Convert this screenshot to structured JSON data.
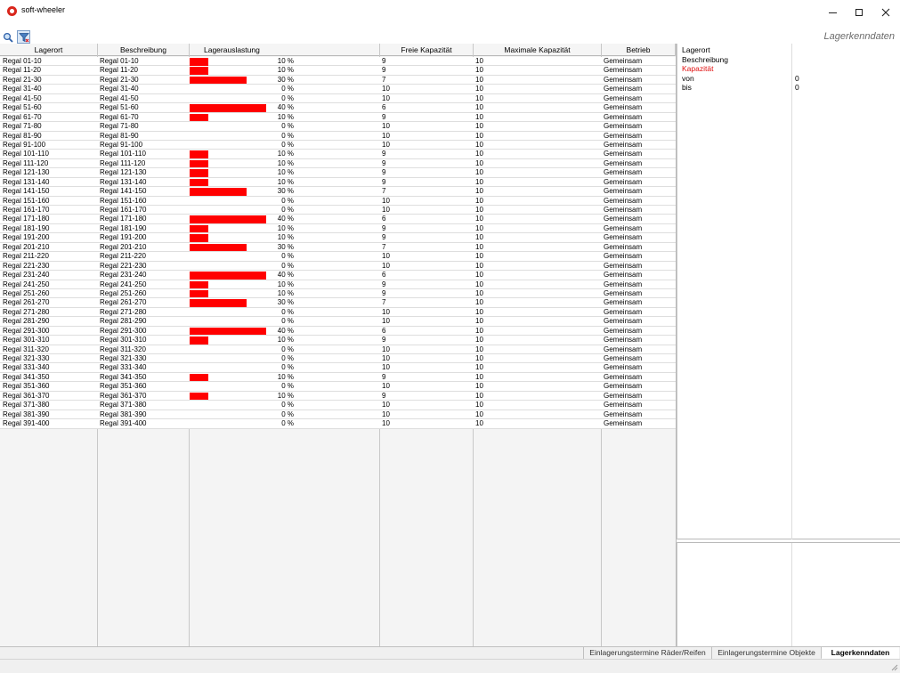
{
  "window": {
    "title": "soft-wheeler"
  },
  "toolbar": {
    "search_icon": "search-icon",
    "filter_icon": "filter-icon",
    "panel_title": "Lagerkenndaten"
  },
  "table": {
    "headers": {
      "lagerort": "Lagerort",
      "beschreibung": "Beschreibung",
      "auslastung": "Lagerauslastung",
      "frei": "Freie Kapazität",
      "max": "Maximale Kapazität",
      "betrieb": "Betrieb"
    },
    "bar_color": "#ff0000",
    "rows": [
      {
        "lagerort": "Regal 01-10",
        "beschreibung": "Regal 01-10",
        "pct_label": "10 %",
        "pct": 10,
        "frei": "9",
        "max": "10",
        "betrieb": "Gemeinsam"
      },
      {
        "lagerort": "Regal 11-20",
        "beschreibung": "Regal 11-20",
        "pct_label": "10 %",
        "pct": 10,
        "frei": "9",
        "max": "10",
        "betrieb": "Gemeinsam"
      },
      {
        "lagerort": "Regal 21-30",
        "beschreibung": "Regal 21-30",
        "pct_label": "30 %",
        "pct": 30,
        "frei": "7",
        "max": "10",
        "betrieb": "Gemeinsam"
      },
      {
        "lagerort": "Regal 31-40",
        "beschreibung": "Regal 31-40",
        "pct_label": "0 %",
        "pct": 0,
        "frei": "10",
        "max": "10",
        "betrieb": "Gemeinsam"
      },
      {
        "lagerort": "Regal 41-50",
        "beschreibung": "Regal 41-50",
        "pct_label": "0 %",
        "pct": 0,
        "frei": "10",
        "max": "10",
        "betrieb": "Gemeinsam"
      },
      {
        "lagerort": "Regal 51-60",
        "beschreibung": "Regal 51-60",
        "pct_label": "40 %",
        "pct": 40,
        "frei": "6",
        "max": "10",
        "betrieb": "Gemeinsam"
      },
      {
        "lagerort": "Regal 61-70",
        "beschreibung": "Regal 61-70",
        "pct_label": "10 %",
        "pct": 10,
        "frei": "9",
        "max": "10",
        "betrieb": "Gemeinsam"
      },
      {
        "lagerort": "Regal 71-80",
        "beschreibung": "Regal 71-80",
        "pct_label": "0 %",
        "pct": 0,
        "frei": "10",
        "max": "10",
        "betrieb": "Gemeinsam"
      },
      {
        "lagerort": "Regal 81-90",
        "beschreibung": "Regal 81-90",
        "pct_label": "0 %",
        "pct": 0,
        "frei": "10",
        "max": "10",
        "betrieb": "Gemeinsam"
      },
      {
        "lagerort": "Regal 91-100",
        "beschreibung": "Regal 91-100",
        "pct_label": "0 %",
        "pct": 0,
        "frei": "10",
        "max": "10",
        "betrieb": "Gemeinsam"
      },
      {
        "lagerort": "Regal 101-110",
        "beschreibung": "Regal 101-110",
        "pct_label": "10 %",
        "pct": 10,
        "frei": "9",
        "max": "10",
        "betrieb": "Gemeinsam"
      },
      {
        "lagerort": "Regal 111-120",
        "beschreibung": "Regal 111-120",
        "pct_label": "10 %",
        "pct": 10,
        "frei": "9",
        "max": "10",
        "betrieb": "Gemeinsam"
      },
      {
        "lagerort": "Regal 121-130",
        "beschreibung": "Regal 121-130",
        "pct_label": "10 %",
        "pct": 10,
        "frei": "9",
        "max": "10",
        "betrieb": "Gemeinsam"
      },
      {
        "lagerort": "Regal 131-140",
        "beschreibung": "Regal 131-140",
        "pct_label": "10 %",
        "pct": 10,
        "frei": "9",
        "max": "10",
        "betrieb": "Gemeinsam"
      },
      {
        "lagerort": "Regal 141-150",
        "beschreibung": "Regal 141-150",
        "pct_label": "30 %",
        "pct": 30,
        "frei": "7",
        "max": "10",
        "betrieb": "Gemeinsam"
      },
      {
        "lagerort": "Regal 151-160",
        "beschreibung": "Regal 151-160",
        "pct_label": "0 %",
        "pct": 0,
        "frei": "10",
        "max": "10",
        "betrieb": "Gemeinsam"
      },
      {
        "lagerort": "Regal 161-170",
        "beschreibung": "Regal 161-170",
        "pct_label": "0 %",
        "pct": 0,
        "frei": "10",
        "max": "10",
        "betrieb": "Gemeinsam"
      },
      {
        "lagerort": "Regal 171-180",
        "beschreibung": "Regal 171-180",
        "pct_label": "40 %",
        "pct": 40,
        "frei": "6",
        "max": "10",
        "betrieb": "Gemeinsam"
      },
      {
        "lagerort": "Regal 181-190",
        "beschreibung": "Regal 181-190",
        "pct_label": "10 %",
        "pct": 10,
        "frei": "9",
        "max": "10",
        "betrieb": "Gemeinsam"
      },
      {
        "lagerort": "Regal 191-200",
        "beschreibung": "Regal 191-200",
        "pct_label": "10 %",
        "pct": 10,
        "frei": "9",
        "max": "10",
        "betrieb": "Gemeinsam"
      },
      {
        "lagerort": "Regal 201-210",
        "beschreibung": "Regal 201-210",
        "pct_label": "30 %",
        "pct": 30,
        "frei": "7",
        "max": "10",
        "betrieb": "Gemeinsam"
      },
      {
        "lagerort": "Regal 211-220",
        "beschreibung": "Regal 211-220",
        "pct_label": "0 %",
        "pct": 0,
        "frei": "10",
        "max": "10",
        "betrieb": "Gemeinsam"
      },
      {
        "lagerort": "Regal 221-230",
        "beschreibung": "Regal 221-230",
        "pct_label": "0 %",
        "pct": 0,
        "frei": "10",
        "max": "10",
        "betrieb": "Gemeinsam"
      },
      {
        "lagerort": "Regal 231-240",
        "beschreibung": "Regal 231-240",
        "pct_label": "40 %",
        "pct": 40,
        "frei": "6",
        "max": "10",
        "betrieb": "Gemeinsam"
      },
      {
        "lagerort": "Regal 241-250",
        "beschreibung": "Regal 241-250",
        "pct_label": "10 %",
        "pct": 10,
        "frei": "9",
        "max": "10",
        "betrieb": "Gemeinsam"
      },
      {
        "lagerort": "Regal 251-260",
        "beschreibung": "Regal 251-260",
        "pct_label": "10 %",
        "pct": 10,
        "frei": "9",
        "max": "10",
        "betrieb": "Gemeinsam"
      },
      {
        "lagerort": "Regal 261-270",
        "beschreibung": "Regal 261-270",
        "pct_label": "30 %",
        "pct": 30,
        "frei": "7",
        "max": "10",
        "betrieb": "Gemeinsam"
      },
      {
        "lagerort": "Regal 271-280",
        "beschreibung": "Regal 271-280",
        "pct_label": "0 %",
        "pct": 0,
        "frei": "10",
        "max": "10",
        "betrieb": "Gemeinsam"
      },
      {
        "lagerort": "Regal 281-290",
        "beschreibung": "Regal 281-290",
        "pct_label": "0 %",
        "pct": 0,
        "frei": "10",
        "max": "10",
        "betrieb": "Gemeinsam"
      },
      {
        "lagerort": "Regal 291-300",
        "beschreibung": "Regal 291-300",
        "pct_label": "40 %",
        "pct": 40,
        "frei": "6",
        "max": "10",
        "betrieb": "Gemeinsam"
      },
      {
        "lagerort": "Regal 301-310",
        "beschreibung": "Regal 301-310",
        "pct_label": "10 %",
        "pct": 10,
        "frei": "9",
        "max": "10",
        "betrieb": "Gemeinsam"
      },
      {
        "lagerort": "Regal 311-320",
        "beschreibung": "Regal 311-320",
        "pct_label": "0 %",
        "pct": 0,
        "frei": "10",
        "max": "10",
        "betrieb": "Gemeinsam"
      },
      {
        "lagerort": "Regal 321-330",
        "beschreibung": "Regal 321-330",
        "pct_label": "0 %",
        "pct": 0,
        "frei": "10",
        "max": "10",
        "betrieb": "Gemeinsam"
      },
      {
        "lagerort": "Regal 331-340",
        "beschreibung": "Regal 331-340",
        "pct_label": "0 %",
        "pct": 0,
        "frei": "10",
        "max": "10",
        "betrieb": "Gemeinsam"
      },
      {
        "lagerort": "Regal 341-350",
        "beschreibung": "Regal 341-350",
        "pct_label": "10 %",
        "pct": 10,
        "frei": "9",
        "max": "10",
        "betrieb": "Gemeinsam"
      },
      {
        "lagerort": "Regal 351-360",
        "beschreibung": "Regal 351-360",
        "pct_label": "0 %",
        "pct": 0,
        "frei": "10",
        "max": "10",
        "betrieb": "Gemeinsam"
      },
      {
        "lagerort": "Regal 361-370",
        "beschreibung": "Regal 361-370",
        "pct_label": "10 %",
        "pct": 10,
        "frei": "9",
        "max": "10",
        "betrieb": "Gemeinsam"
      },
      {
        "lagerort": "Regal 371-380",
        "beschreibung": "Regal 371-380",
        "pct_label": "0 %",
        "pct": 0,
        "frei": "10",
        "max": "10",
        "betrieb": "Gemeinsam"
      },
      {
        "lagerort": "Regal 381-390",
        "beschreibung": "Regal 381-390",
        "pct_label": "0 %",
        "pct": 0,
        "frei": "10",
        "max": "10",
        "betrieb": "Gemeinsam"
      },
      {
        "lagerort": "Regal 391-400",
        "beschreibung": "Regal 391-400",
        "pct_label": "0 %",
        "pct": 0,
        "frei": "10",
        "max": "10",
        "betrieb": "Gemeinsam"
      }
    ]
  },
  "details": {
    "lagerort_label": "Lagerort",
    "beschreibung_label": "Beschreibung",
    "kapazitaet_label": "Kapazität",
    "kapazitaet_color": "#e01010",
    "von_label": "von",
    "von_value": "0",
    "bis_label": "bis",
    "bis_value": "0"
  },
  "tabs": [
    {
      "label": "Einlagerungstermine Räder/Reifen",
      "active": false
    },
    {
      "label": "Einlagerungstermine Objekte",
      "active": false
    },
    {
      "label": "Lagerkenndaten",
      "active": true
    }
  ]
}
